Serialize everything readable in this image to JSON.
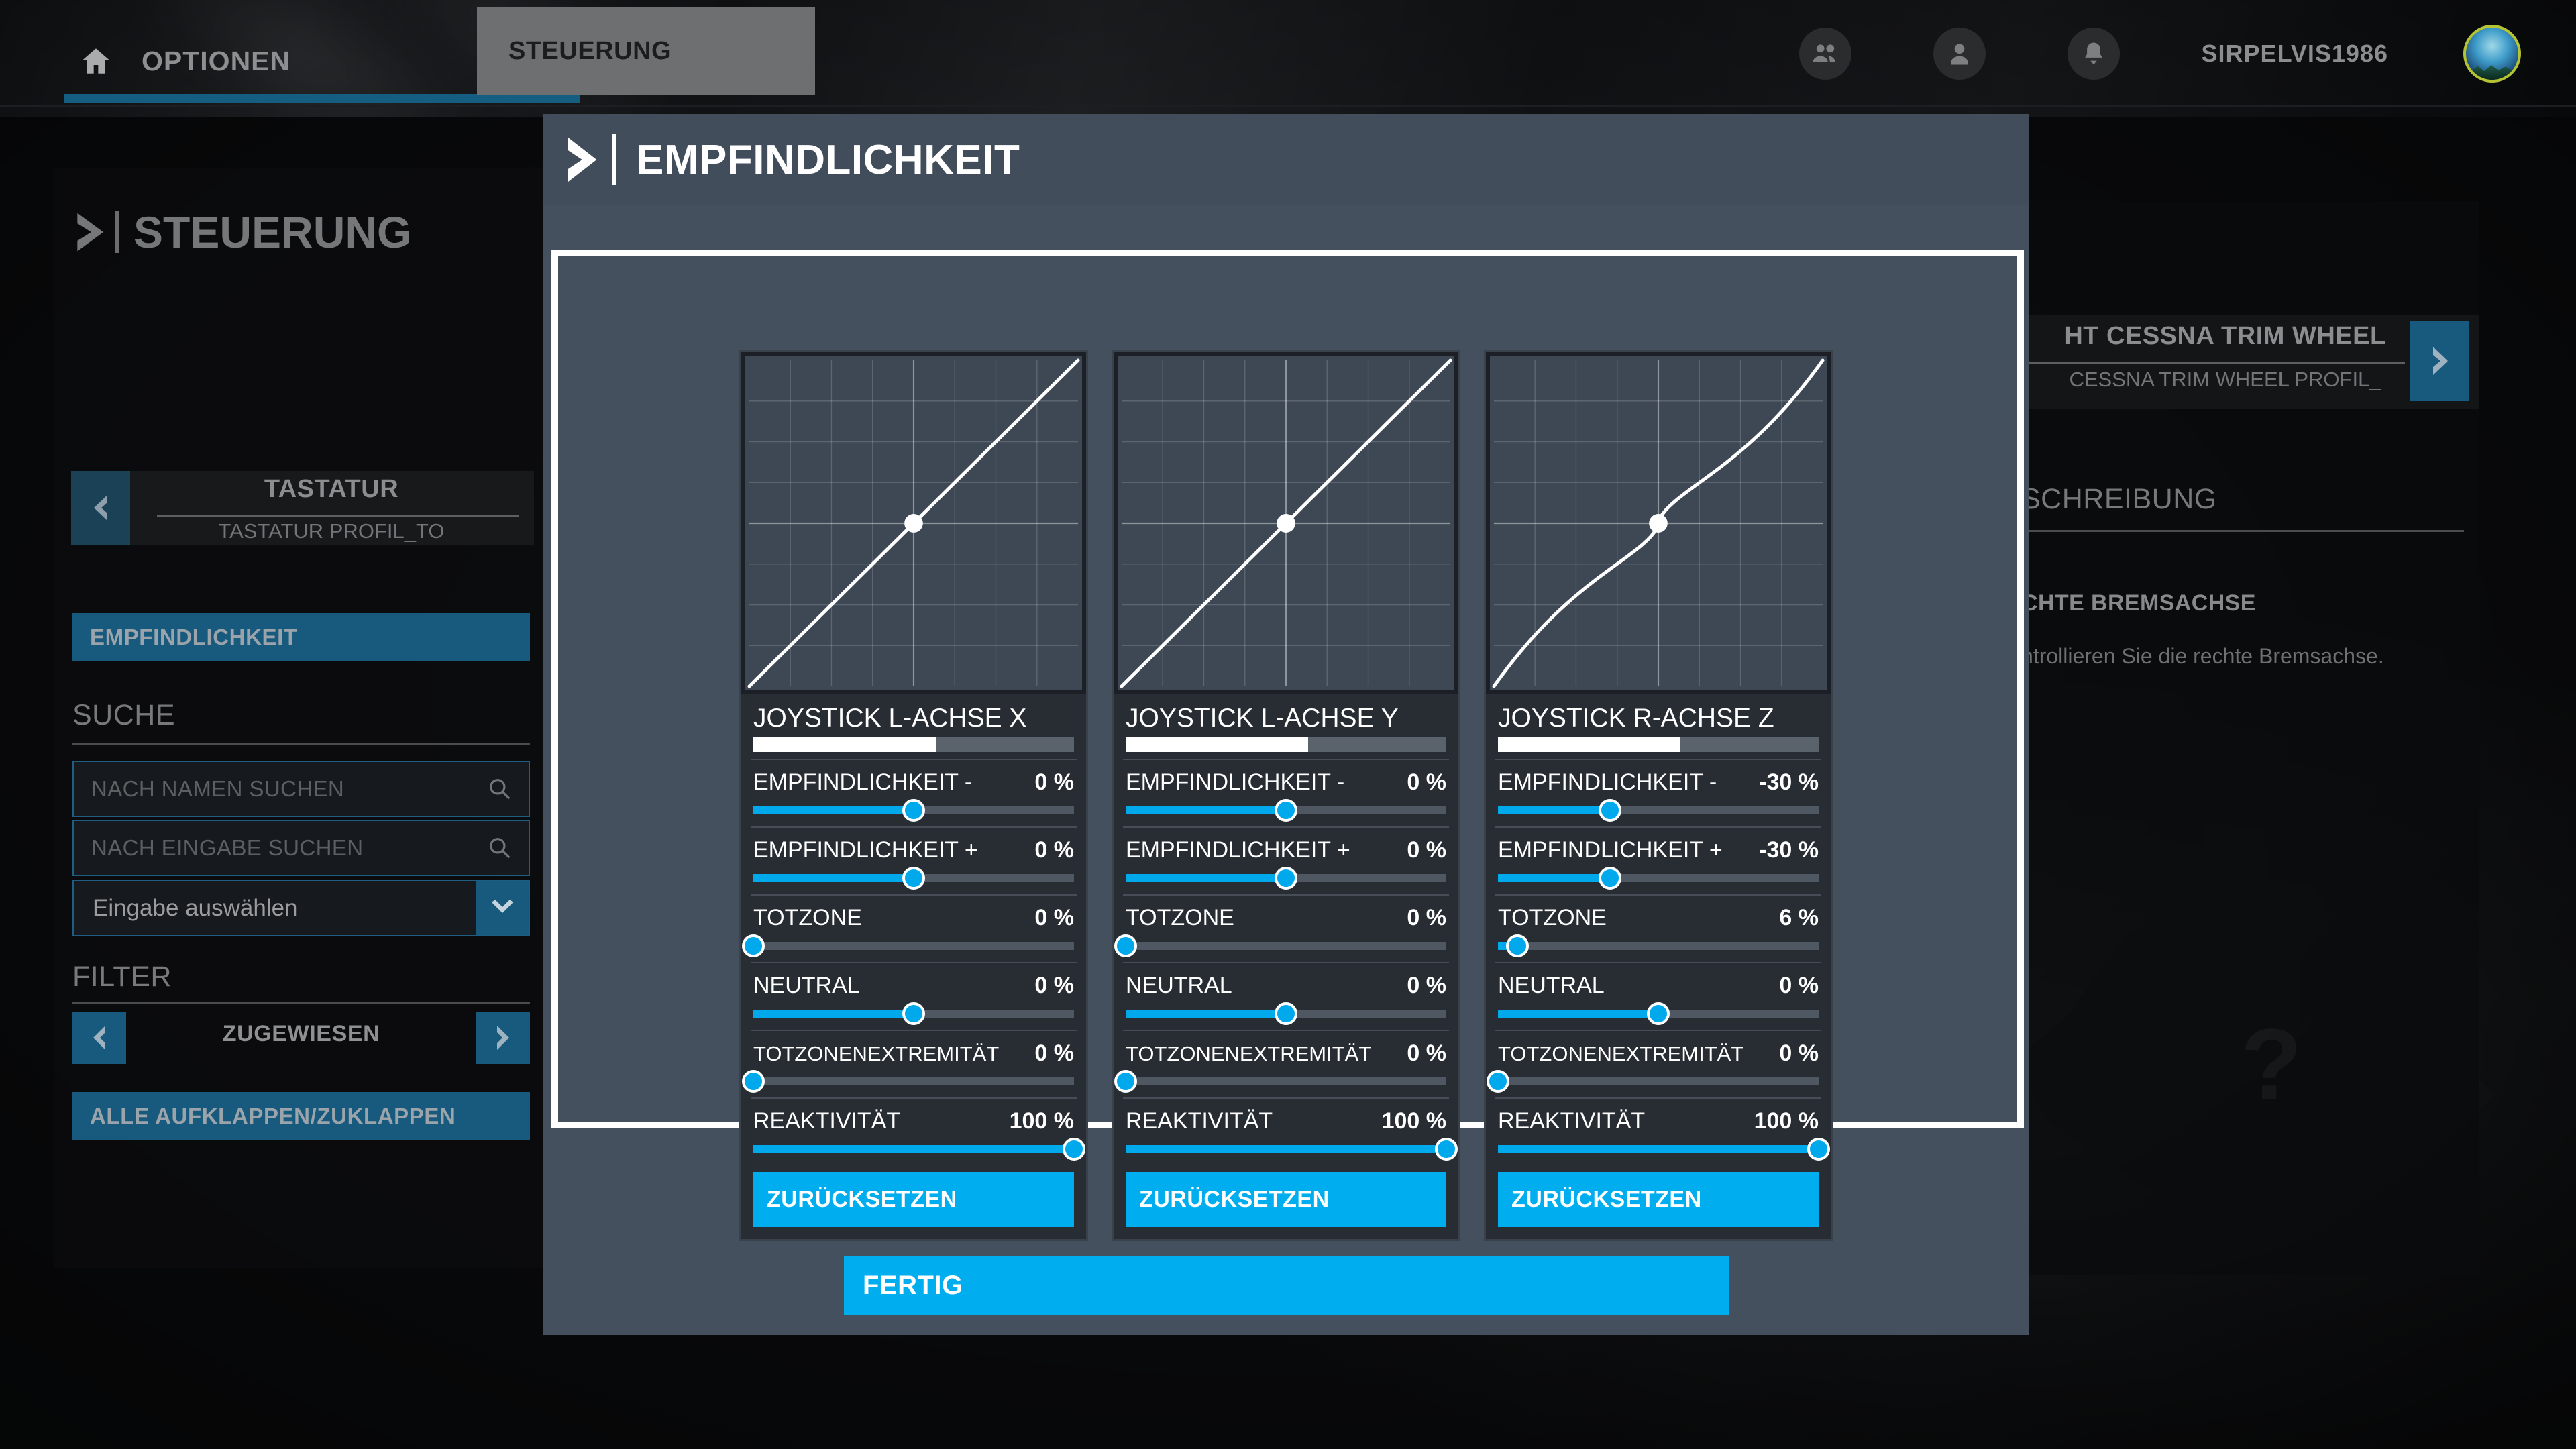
{
  "topnav": {
    "home_icon": "home-icon",
    "tabs": [
      {
        "label": "OPTIONEN",
        "active": true
      },
      {
        "label": "STEUERUNG",
        "active": true
      }
    ],
    "icons": [
      "friends-icon",
      "profile-icon",
      "bell-icon"
    ],
    "username": "SIRPELVIS1986"
  },
  "sidebar": {
    "title": "STEUERUNG",
    "device": {
      "name": "TASTATUR",
      "profile": "TASTATUR PROFIL_TO"
    },
    "sensitivity_button": "EMPFINDLICHKEIT",
    "search": {
      "heading": "SUCHE",
      "name_placeholder": "NACH NAMEN SUCHEN",
      "input_placeholder": "NACH EINGABE SUCHEN",
      "select_value": "Eingabe auswählen"
    },
    "filter": {
      "heading": "FILTER",
      "value": "ZUGEWIESEN"
    },
    "expand_button": "ALLE AUFKLAPPEN/ZUKLAPPEN"
  },
  "right_panel": {
    "device_name": "HT CESSNA TRIM WHEEL",
    "device_profile": "CESSNA TRIM WHEEL PROFIL_",
    "section_heading": "SCHREIBUNG",
    "binding_name": "CHTE BREMSACHSE",
    "description": "ntrollieren Sie die rechte Bremsachse.",
    "placeholder_glyph": "?"
  },
  "modal": {
    "title": "EMPFINDLICHKEIT",
    "done_label": "FERTIG",
    "reset_label": "ZURÜCKSETZEN",
    "colors": {
      "accent": "#00aeef",
      "slider": "#00a9ec",
      "panel_bg": "#44505d",
      "card_bg": "#282d34",
      "graph_bg": "#3d4854",
      "sidebar_blue": "#175a7e"
    },
    "slider_labels": {
      "sens_minus": "EMPFINDLICHKEIT -",
      "sens_plus": "EMPFINDLICHKEIT +",
      "deadzone": "TOTZONE",
      "neutral": "NEUTRAL",
      "deadzone_extremity": "TOTZONENEXTREMITÄT",
      "reactivity": "REAKTIVITÄT"
    },
    "axes": [
      {
        "title": "JOYSTICK L-ACHSE X",
        "meter_percent": 57,
        "curve": "linear",
        "sliders": [
          {
            "key": "sens_minus",
            "value": "0 %",
            "pos": 50
          },
          {
            "key": "sens_plus",
            "value": "0 %",
            "pos": 50
          },
          {
            "key": "deadzone",
            "value": "0 %",
            "pos": 0
          },
          {
            "key": "neutral",
            "value": "0 %",
            "pos": 50
          },
          {
            "key": "deadzone_extremity",
            "value": "0 %",
            "pos": 0
          },
          {
            "key": "reactivity",
            "value": "100 %",
            "pos": 100
          }
        ]
      },
      {
        "title": "JOYSTICK L-ACHSE Y",
        "meter_percent": 57,
        "curve": "linear",
        "sliders": [
          {
            "key": "sens_minus",
            "value": "0 %",
            "pos": 50
          },
          {
            "key": "sens_plus",
            "value": "0 %",
            "pos": 50
          },
          {
            "key": "deadzone",
            "value": "0 %",
            "pos": 0
          },
          {
            "key": "neutral",
            "value": "0 %",
            "pos": 50
          },
          {
            "key": "deadzone_extremity",
            "value": "0 %",
            "pos": 0
          },
          {
            "key": "reactivity",
            "value": "100 %",
            "pos": 100
          }
        ]
      },
      {
        "title": "JOYSTICK R-ACHSE Z",
        "meter_percent": 57,
        "curve": "scurve",
        "sliders": [
          {
            "key": "sens_minus",
            "value": "-30 %",
            "pos": 35
          },
          {
            "key": "sens_plus",
            "value": "-30 %",
            "pos": 35
          },
          {
            "key": "deadzone",
            "value": "6 %",
            "pos": 6
          },
          {
            "key": "neutral",
            "value": "0 %",
            "pos": 50
          },
          {
            "key": "deadzone_extremity",
            "value": "0 %",
            "pos": 0
          },
          {
            "key": "reactivity",
            "value": "100 %",
            "pos": 100
          }
        ]
      }
    ]
  },
  "chart_data": [
    {
      "type": "line",
      "title": "JOYSTICK L-ACHSE X",
      "x": [
        -1,
        -0.5,
        0,
        0.5,
        1
      ],
      "y": [
        -1,
        -0.5,
        0,
        0.5,
        1
      ],
      "xlim": [
        -1,
        1
      ],
      "ylim": [
        -1,
        1
      ],
      "grid": true,
      "legend": "none",
      "annotations": [
        "center point at (0,0)"
      ]
    },
    {
      "type": "line",
      "title": "JOYSTICK L-ACHSE Y",
      "x": [
        -1,
        -0.5,
        0,
        0.5,
        1
      ],
      "y": [
        -1,
        -0.5,
        0,
        0.5,
        1
      ],
      "xlim": [
        -1,
        1
      ],
      "ylim": [
        -1,
        1
      ],
      "grid": true,
      "legend": "none",
      "annotations": [
        "center point at (0,0)"
      ]
    },
    {
      "type": "line",
      "title": "JOYSTICK R-ACHSE Z",
      "x": [
        -1,
        -0.75,
        -0.5,
        -0.25,
        0,
        0.25,
        0.5,
        0.75,
        1
      ],
      "y": [
        -1,
        -0.72,
        -0.48,
        -0.25,
        0,
        0.25,
        0.48,
        0.72,
        1
      ],
      "xlim": [
        -1,
        1
      ],
      "ylim": [
        -1,
        1
      ],
      "grid": true,
      "legend": "none",
      "annotations": [
        "inverse S-curve, sensitivity -30%",
        "center point at (0,0)"
      ]
    }
  ]
}
